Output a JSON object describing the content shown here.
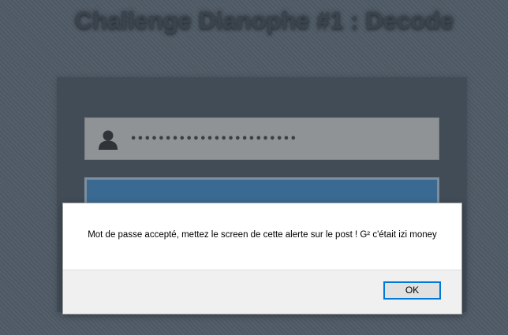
{
  "page": {
    "title": "Challenge Dianophe #1 : Decode"
  },
  "login": {
    "password_masked": "••••••••••••••••••••••••",
    "user_icon": "user-icon"
  },
  "alert": {
    "message": "Mot de passe accepté, mettez le screen de cette alerte sur le post ! G² c'était izi money",
    "ok_label": "OK"
  },
  "colors": {
    "background": "#4f5b66",
    "panel": "#414c57",
    "field": "#909396",
    "button": "#3a6a92",
    "ok_border": "#0078d7"
  }
}
